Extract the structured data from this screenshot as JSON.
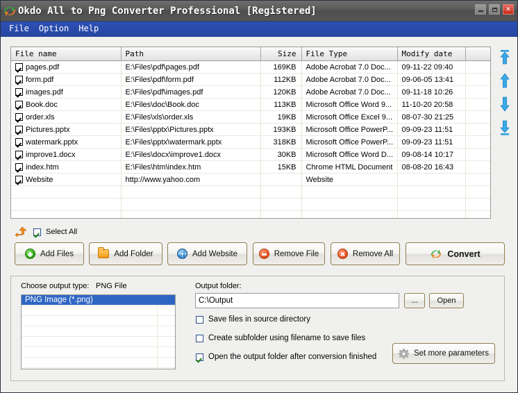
{
  "window": {
    "title": "Okdo All to Png Converter Professional [Registered]",
    "icon": "convert-swirl-icon",
    "controls": {
      "minimize": "minimize-button",
      "maximize": "maximize-button",
      "close": "close-button"
    }
  },
  "menu": {
    "items": [
      "File",
      "Option",
      "Help"
    ]
  },
  "file_table": {
    "columns": [
      "File name",
      "Path",
      "Size",
      "File Type",
      "Modify date",
      ""
    ],
    "rows": [
      {
        "checked": true,
        "name": "pages.pdf",
        "path": "E:\\Files\\pdf\\pages.pdf",
        "size": "169KB",
        "type": "Adobe Acrobat 7.0 Doc...",
        "modified": "09-11-22 09:40"
      },
      {
        "checked": true,
        "name": "form.pdf",
        "path": "E:\\Files\\pdf\\form.pdf",
        "size": "112KB",
        "type": "Adobe Acrobat 7.0 Doc...",
        "modified": "09-06-05 13:41"
      },
      {
        "checked": true,
        "name": "images.pdf",
        "path": "E:\\Files\\pdf\\images.pdf",
        "size": "120KB",
        "type": "Adobe Acrobat 7.0 Doc...",
        "modified": "09-11-18 10:26"
      },
      {
        "checked": true,
        "name": "Book.doc",
        "path": "E:\\Files\\doc\\Book.doc",
        "size": "113KB",
        "type": "Microsoft Office Word 9...",
        "modified": "11-10-20 20:58"
      },
      {
        "checked": true,
        "name": "order.xls",
        "path": "E:\\Files\\xls\\order.xls",
        "size": "19KB",
        "type": "Microsoft Office Excel 9...",
        "modified": "08-07-30 21:25"
      },
      {
        "checked": true,
        "name": "Pictures.pptx",
        "path": "E:\\Files\\pptx\\Pictures.pptx",
        "size": "193KB",
        "type": "Microsoft Office PowerP...",
        "modified": "09-09-23 11:51"
      },
      {
        "checked": true,
        "name": "watermark.pptx",
        "path": "E:\\Files\\pptx\\watermark.pptx",
        "size": "318KB",
        "type": "Microsoft Office PowerP...",
        "modified": "09-09-23 11:51"
      },
      {
        "checked": true,
        "name": "improve1.docx",
        "path": "E:\\Files\\docx\\improve1.docx",
        "size": "30KB",
        "type": "Microsoft Office Word D...",
        "modified": "09-08-14 10:17"
      },
      {
        "checked": true,
        "name": "index.htm",
        "path": "E:\\Files\\htm\\index.htm",
        "size": "15KB",
        "type": "Chrome HTML Document",
        "modified": "08-08-20 16:43"
      },
      {
        "checked": true,
        "name": "Website",
        "path": "http://www.yahoo.com",
        "size": "",
        "type": "Website",
        "modified": ""
      }
    ],
    "empty_rows": 3
  },
  "move_buttons": [
    {
      "name": "move-to-top-button"
    },
    {
      "name": "move-up-button"
    },
    {
      "name": "move-down-button"
    },
    {
      "name": "move-to-bottom-button"
    }
  ],
  "select_all": {
    "label": "Select All",
    "checked": true
  },
  "toolbar": {
    "add_files": "Add Files",
    "add_folder": "Add Folder",
    "add_website": "Add Website",
    "remove_file": "Remove File",
    "remove_all": "Remove All",
    "convert": "Convert"
  },
  "output": {
    "choose_label": "Choose output type:",
    "choose_value": "PNG File",
    "type_options": [
      "PNG Image (*.png)"
    ],
    "selected_type": "PNG Image (*.png)",
    "folder_label": "Output folder:",
    "folder_value": "C:\\Output",
    "folder_placeholder": "",
    "browse_label": "...",
    "open_label": "Open",
    "options": [
      {
        "label": "Save files in source directory",
        "checked": false
      },
      {
        "label": "Create subfolder using filename to save files",
        "checked": false
      },
      {
        "label": "Open the output folder after conversion finished",
        "checked": true
      }
    ],
    "set_more_label": "Set more parameters"
  },
  "colors": {
    "titlebar": "#5b5b5b",
    "menubar": "#2a4bab",
    "selection": "#2f66c4",
    "button_border": "#8d7f52",
    "arrow_blue": "#2f9ee0",
    "accent_orange": "#f08a1c"
  }
}
